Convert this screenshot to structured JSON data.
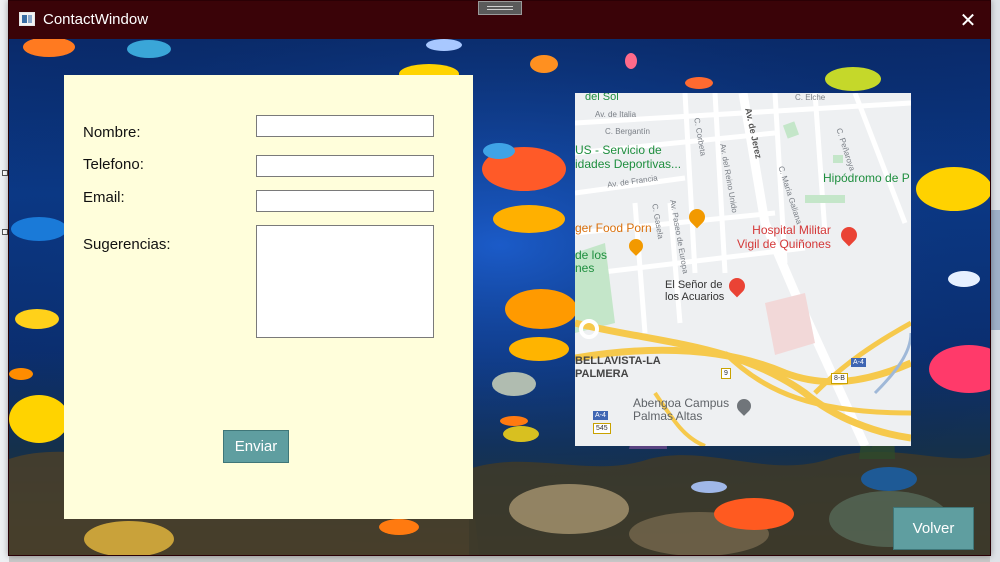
{
  "window": {
    "title": "ContactWindow",
    "close_glyph": "✕",
    "title_bar_color": "#3a0308"
  },
  "form": {
    "nombre_label": "Nombre:",
    "telefono_label": "Telefono:",
    "email_label": "Email:",
    "sugerencias_label": "Sugerencias:",
    "nombre_value": "",
    "telefono_value": "",
    "email_value": "",
    "sugerencias_value": "",
    "submit_label": "Enviar",
    "panel_color": "#fffedb"
  },
  "map": {
    "streets": [
      "del Sol",
      "Av. de Italia",
      "C. Bergantín",
      "C. Corbeta",
      "Av. de Jerez",
      "Av. del Reino Unido",
      "C. María Galiana",
      "C. Peñaroya",
      "C. Elche",
      "Av. de Francia",
      "Av. Paseo de Europa",
      "C. Gasela"
    ],
    "pois": {
      "sports": "US - Servicio de\nidades Deportivas...",
      "racecourse": "Hipódromo de P",
      "food": "ger Food Porn",
      "hospital": "Hospital Militar\nVigil de Quiñones",
      "park": "de los\nnes",
      "aquarium": "El Señor de\nlos Acuarios",
      "district": "BELLAVISTA-LA\nPALMERA",
      "campus": "Abengoa Campus\nPalmas Altas"
    },
    "road_labels": [
      "A-4",
      "A-4",
      "8-B",
      "9",
      "545"
    ]
  },
  "footer": {
    "back_label": "Volver"
  },
  "colors": {
    "button": "#5f9ea0",
    "button_text": "#ffffff"
  },
  "icons": [
    "app-icon",
    "close-icon",
    "fork-knife-icon",
    "hospital-icon",
    "shopping-bag-icon",
    "map-pin-icon"
  ]
}
